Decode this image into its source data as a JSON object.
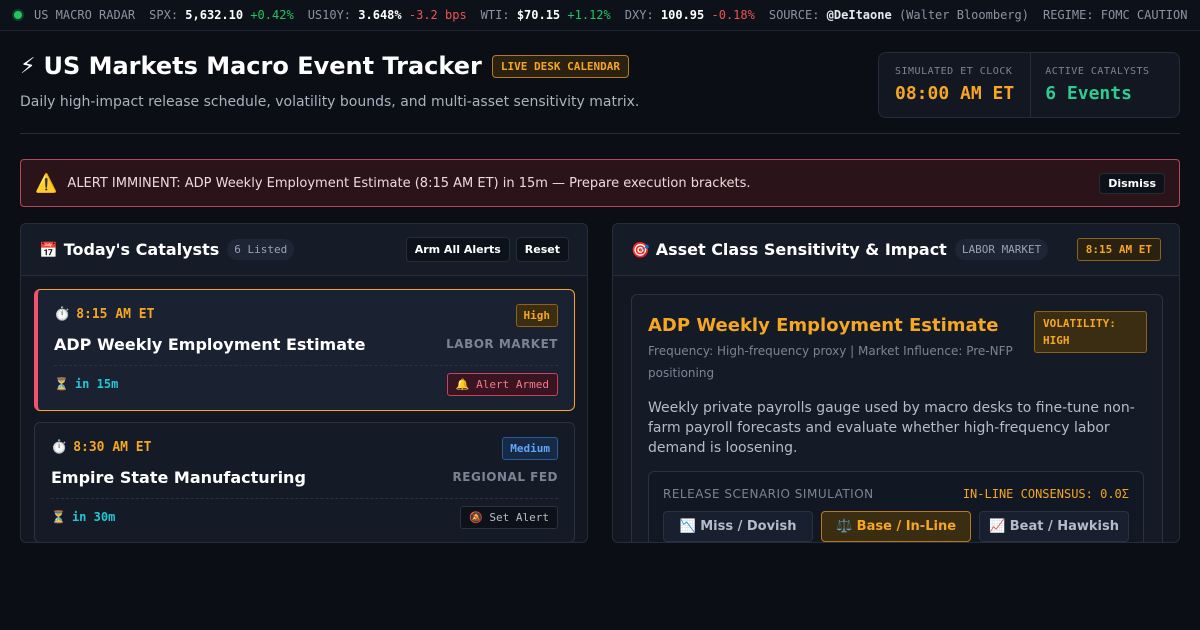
{
  "ticker": {
    "name": "US MACRO RADAR",
    "items": [
      {
        "label": "SPX:",
        "value": "5,632.10",
        "change": "+0.42%",
        "dir": "pos"
      },
      {
        "label": "US10Y:",
        "value": "3.648%",
        "change": "-3.2 bps",
        "dir": "neg"
      },
      {
        "label": "WTI:",
        "value": "$70.15",
        "change": "+1.12%",
        "dir": "pos"
      },
      {
        "label": "DXY:",
        "value": "100.95",
        "change": "-0.18%",
        "dir": "neg"
      }
    ],
    "source_label": "SOURCE:",
    "source_handle": "@DeItaone",
    "source_name": "(Walter Bloomberg)",
    "regime": "REGIME: FOMC CAUTION"
  },
  "header": {
    "icon": "⚡",
    "title": "US Markets Macro Event Tracker",
    "badge": "LIVE DESK CALENDAR",
    "subtitle": "Daily high-impact release schedule, volatility bounds, and multi-asset sensitivity matrix.",
    "clock_label": "SIMULATED ET CLOCK",
    "clock_value": "08:00 AM ET",
    "catalysts_label": "ACTIVE CATALYSTS",
    "catalysts_value": "6 Events"
  },
  "alert": {
    "icon": "⚠️",
    "text": "ALERT IMMINENT: ADP Weekly Employment Estimate (8:15 AM ET) in 15m — Prepare execution brackets.",
    "dismiss": "Dismiss"
  },
  "catalysts": {
    "icon": "📅",
    "title": "Today's Catalysts",
    "count": "6 Listed",
    "arm_all": "Arm All Alerts",
    "reset": "Reset",
    "events": [
      {
        "time": "8:15 AM ET",
        "severity": "High",
        "name": "ADP Weekly Employment Estimate",
        "category": "LABOR MARKET",
        "eta": "in 15m",
        "alert": "🔔 Alert Armed"
      },
      {
        "time": "8:30 AM ET",
        "severity": "Medium",
        "name": "Empire State Manufacturing",
        "category": "REGIONAL FED",
        "eta": "in 30m",
        "alert": "🔕 Set Alert"
      }
    ],
    "time_icon": "⏱️",
    "eta_icon": "⏳"
  },
  "sensitivity": {
    "icon": "🎯",
    "title": "Asset Class Sensitivity & Impact",
    "category": "LABOR MARKET",
    "time": "8:15 AM ET",
    "event_title": "ADP Weekly Employment Estimate",
    "volatility": "VOLATILITY: HIGH",
    "meta": "Frequency: High-frequency proxy | Market Influence: Pre-NFP positioning",
    "description": "Weekly private payrolls gauge used by macro desks to fine-tune non-farm payroll forecasts and evaluate whether high-frequency labor demand is loosening.",
    "sim_label": "RELEASE SCENARIO SIMULATION",
    "sim_consensus": "IN-LINE CONSENSUS: 0.0Σ",
    "scenarios": [
      "📉 Miss / Dovish",
      "⚖️ Base / In-Line",
      "📈 Beat / Hawkish"
    ]
  }
}
